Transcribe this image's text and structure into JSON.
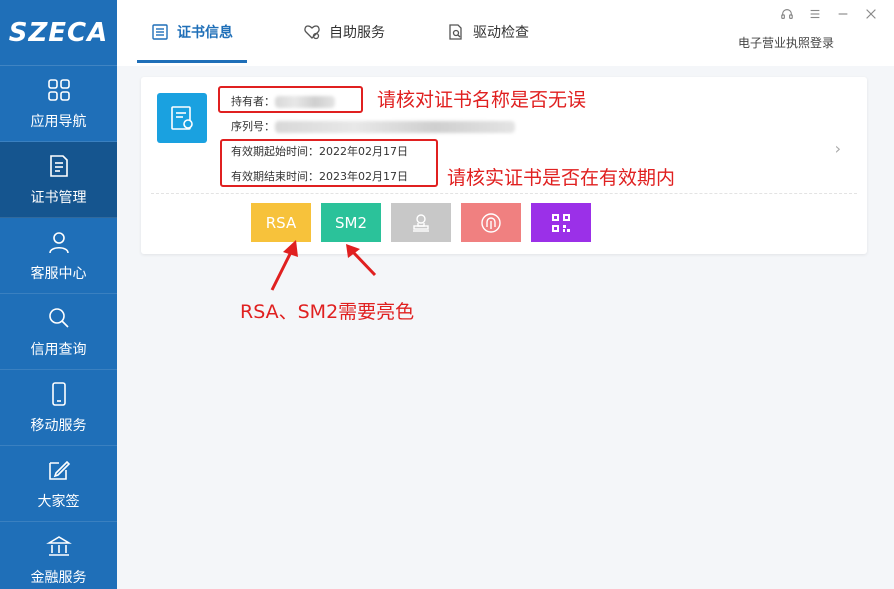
{
  "logo": {
    "text": "SZECA"
  },
  "sidebar": {
    "items": [
      {
        "label": "应用导航",
        "icon": "grid-icon"
      },
      {
        "label": "证书管理",
        "icon": "document-icon",
        "active": true
      },
      {
        "label": "客服中心",
        "icon": "user-icon"
      },
      {
        "label": "信用查询",
        "icon": "search-icon"
      },
      {
        "label": "移动服务",
        "icon": "phone-icon"
      },
      {
        "label": "大家签",
        "icon": "edit-icon"
      },
      {
        "label": "金融服务",
        "icon": "bank-icon"
      }
    ]
  },
  "header": {
    "tabs": [
      {
        "label": "证书信息",
        "icon": "list-icon",
        "active": true
      },
      {
        "label": "自助服务",
        "icon": "heart-gear-icon"
      },
      {
        "label": "驱动检查",
        "icon": "doc-search-icon"
      }
    ],
    "login_link": "电子营业执照登录",
    "window_controls": [
      "headset-icon",
      "menu-icon",
      "minimize-icon",
      "close-icon"
    ]
  },
  "certificate": {
    "holder_label": "持有者：",
    "serial_label": "序列号：",
    "valid_from_label": "有效期起始时间：",
    "valid_from": "2022年02月17日",
    "valid_to_label": "有效期结束时间：",
    "valid_to": "2023年02月17日"
  },
  "algorithm_buttons": [
    {
      "label": "RSA",
      "color": "#f7c23b"
    },
    {
      "label": "SM2",
      "color": "#2bc29a"
    },
    {
      "label": "",
      "icon": "seal-icon",
      "color": "#c8c8c8"
    },
    {
      "label": "",
      "icon": "fingerprint-icon",
      "color": "#f08080"
    },
    {
      "label": "",
      "icon": "qrcode-icon",
      "color": "#9b30e8"
    }
  ],
  "annotations": {
    "name_check": "请核对证书名称是否无误",
    "validity_check": "请核实证书是否在有效期内",
    "algorithm_note": "RSA、SM2需要亮色"
  },
  "colors": {
    "sidebar": "#1f6fb8",
    "sidebar_active": "#15558f",
    "accent": "#1f6fb8",
    "annotation": "#e02020"
  }
}
